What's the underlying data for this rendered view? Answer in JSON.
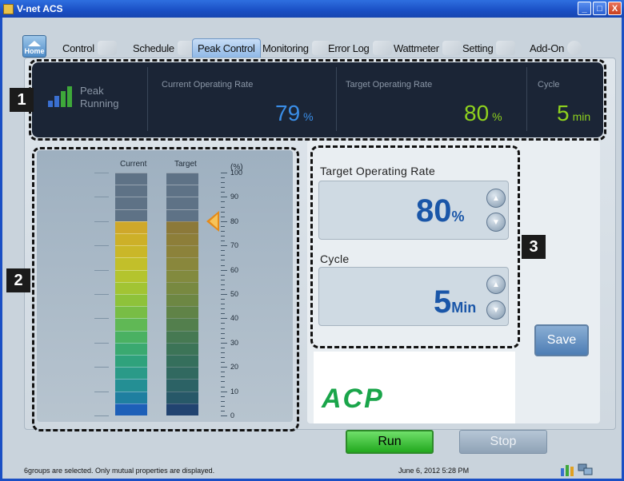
{
  "window": {
    "title": "V-net ACS",
    "buttons": [
      "_",
      "□",
      "X"
    ]
  },
  "nav": {
    "home_label": "Home",
    "tabs": [
      {
        "label": "Control",
        "active": false
      },
      {
        "label": "Schedule",
        "active": false
      },
      {
        "label": "Peak Control",
        "active": true
      },
      {
        "label": "Monitoring",
        "active": false
      },
      {
        "label": "Error Log",
        "active": false
      },
      {
        "label": "Wattmeter",
        "active": false
      },
      {
        "label": "Setting",
        "active": false
      },
      {
        "label": "Add-On",
        "active": false
      }
    ]
  },
  "status_strip": {
    "state_line1": "Peak",
    "state_line2": "Running",
    "current_label": "Current Operating Rate",
    "current_value": "79",
    "current_unit": "%",
    "target_label": "Target Operating Rate",
    "target_value": "80",
    "target_unit": "%",
    "cycle_label": "Cycle",
    "cycle_value": "5",
    "cycle_unit": "min"
  },
  "gauge": {
    "current_label": "Current",
    "target_label": "Target",
    "unit_label": "(%)",
    "scale": [
      "100",
      "90",
      "80",
      "70",
      "60",
      "50",
      "40",
      "30",
      "20",
      "10",
      "0"
    ],
    "current_percent": 79,
    "target_percent": 80
  },
  "settings": {
    "target_label": "Target Operating Rate",
    "target_value": "80",
    "target_unit": "%",
    "cycle_label": "Cycle",
    "cycle_value": "5",
    "cycle_unit": "Min",
    "save_label": "Save"
  },
  "brand": {
    "text": "ACP"
  },
  "actions": {
    "run_label": "Run",
    "stop_label": "Stop"
  },
  "badges": [
    "1",
    "2",
    "3"
  ],
  "statusbar": {
    "message": "6groups are selected. Only mutual properties are displayed.",
    "datetime": "June 6, 2012  5:28 PM"
  },
  "colors": {
    "accent_blue": "#1a56a8",
    "run_green": "#22a81e",
    "acp_green": "#1aa54a",
    "strip_dark": "#1b2536",
    "current_blue": "#3a8ee8",
    "target_green": "#8fd21e"
  }
}
